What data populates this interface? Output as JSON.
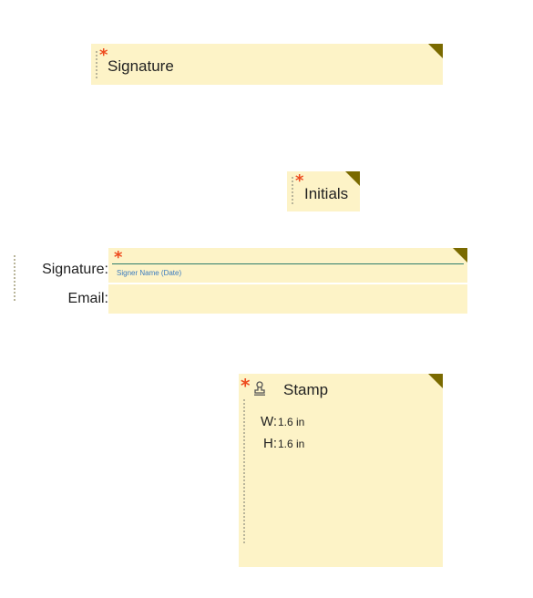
{
  "fields": {
    "signature": {
      "label": "Signature",
      "required_mark": "*"
    },
    "initials": {
      "label": "Initials",
      "required_mark": "*"
    },
    "signature_block": {
      "signature_label": "Signature:",
      "email_label": "Email:",
      "required_mark": "*",
      "signer_placeholder": "Signer Name (Date)"
    },
    "stamp": {
      "title": "Stamp",
      "required_mark": "*",
      "icon": "stamp-icon",
      "width_label": "W:",
      "width_value": "1.6 in",
      "height_label": "H:",
      "height_value": "1.6 in"
    }
  },
  "colors": {
    "field_background": "#fdf3c7",
    "corner_marker": "#7a6a00",
    "required_mark": "#ee4b1f",
    "signature_line": "#2e7d6b",
    "signer_text": "#3a7bbf"
  }
}
